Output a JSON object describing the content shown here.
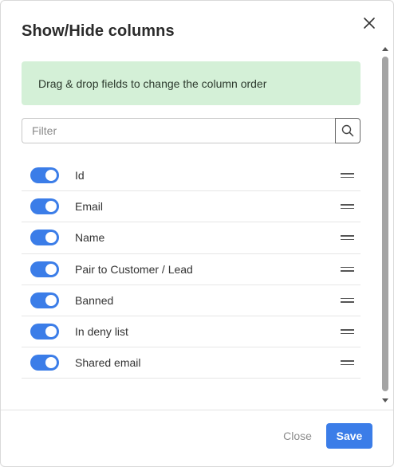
{
  "dialog": {
    "title": "Show/Hide columns",
    "close_icon": "close-icon"
  },
  "info": {
    "text": "Drag & drop fields to change the column order",
    "background": "#d4f0d7"
  },
  "filter": {
    "placeholder": "Filter",
    "value": "",
    "icon": "search-icon"
  },
  "columns": [
    {
      "label": "Id",
      "enabled": true
    },
    {
      "label": "Email",
      "enabled": true
    },
    {
      "label": "Name",
      "enabled": true
    },
    {
      "label": "Pair to Customer / Lead",
      "enabled": true
    },
    {
      "label": "Banned",
      "enabled": true
    },
    {
      "label": "In deny list",
      "enabled": true
    },
    {
      "label": "Shared email",
      "enabled": true
    }
  ],
  "footer": {
    "close_label": "Close",
    "save_label": "Save"
  },
  "colors": {
    "accent": "#3b7de8"
  }
}
